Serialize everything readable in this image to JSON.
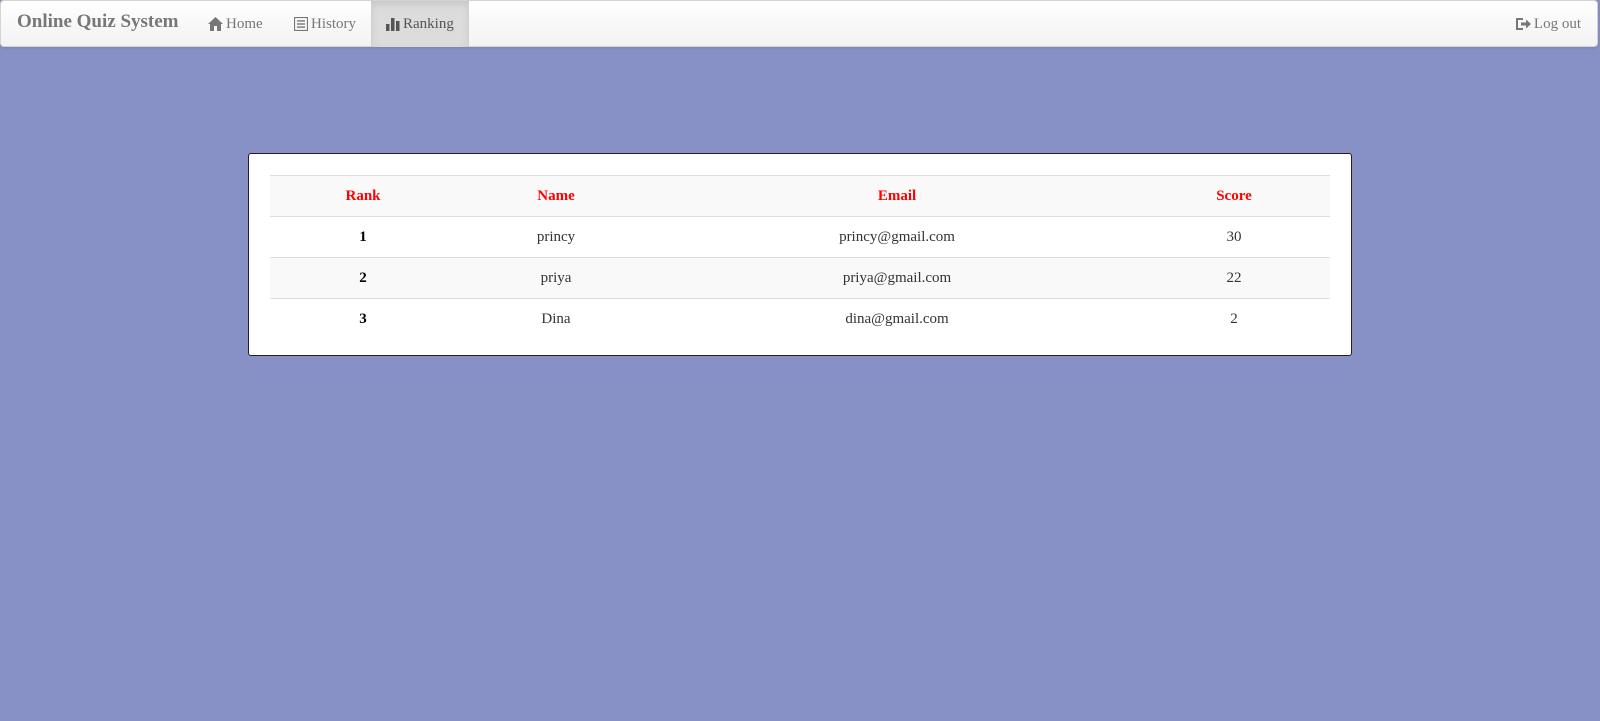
{
  "app": {
    "title": "Online Quiz System"
  },
  "nav": {
    "home_label": "Home",
    "history_label": "History",
    "ranking_label": "Ranking",
    "logout_label": "Log out",
    "active": "Ranking"
  },
  "ranking_table": {
    "headers": {
      "rank": "Rank",
      "name": "Name",
      "email": "Email",
      "score": "Score"
    },
    "rows": [
      {
        "rank": "1",
        "name": "princy",
        "email": "princy@gmail.com",
        "score": "30"
      },
      {
        "rank": "2",
        "name": "priya",
        "email": "priya@gmail.com",
        "score": "22"
      },
      {
        "rank": "3",
        "name": "Dina",
        "email": "dina@gmail.com",
        "score": "2"
      }
    ]
  },
  "colors": {
    "page_background": "#8891c6",
    "header_text": "#ff0000",
    "navbar_text": "#777777"
  },
  "icons": {
    "home": "home-icon",
    "history": "list-alt-icon",
    "ranking": "bar-chart-icon",
    "logout": "log-out-icon"
  }
}
